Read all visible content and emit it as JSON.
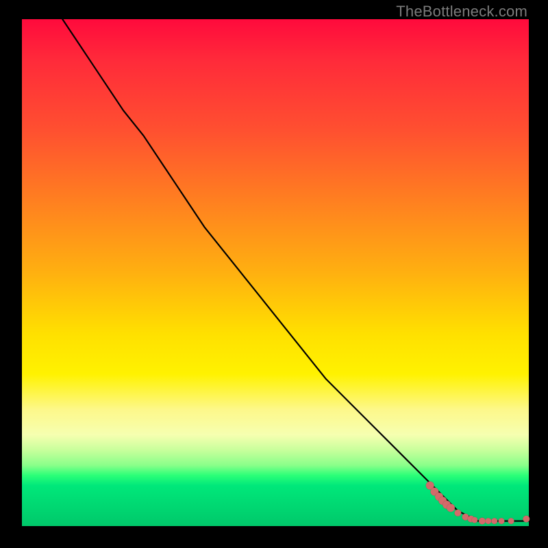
{
  "watermark": "TheBottleneck.com",
  "chart_data": {
    "type": "line",
    "title": "",
    "xlabel": "",
    "ylabel": "",
    "xlim": [
      0,
      100
    ],
    "ylim": [
      0,
      100
    ],
    "series": [
      {
        "name": "bottleneck-curve",
        "x": [
          8,
          12,
          16,
          20,
          24,
          28,
          32,
          36,
          40,
          44,
          48,
          52,
          56,
          60,
          64,
          68,
          72,
          76,
          80,
          82,
          84,
          86,
          88,
          90,
          92,
          94,
          96,
          98,
          100
        ],
        "y": [
          100,
          94,
          88,
          82,
          77,
          71,
          65,
          59,
          54,
          49,
          44,
          39,
          34,
          29,
          25,
          21,
          17,
          13,
          9,
          7,
          5,
          3,
          2,
          1,
          1,
          1,
          1,
          1,
          1
        ]
      }
    ],
    "points": {
      "name": "highlight-tail-points",
      "x": [
        80.5,
        81.4,
        82.3,
        83.0,
        83.8,
        84.6,
        86.0,
        87.5,
        88.6,
        89.3,
        90.8,
        92.0,
        93.2,
        94.6,
        96.5,
        99.5
      ],
      "y": [
        8.0,
        6.8,
        5.8,
        5.0,
        4.2,
        3.6,
        2.6,
        1.8,
        1.4,
        1.2,
        1.0,
        1.0,
        1.0,
        1.0,
        1.0,
        1.4
      ],
      "r": [
        6,
        6,
        6,
        6,
        6,
        6,
        5,
        5,
        5,
        4.5,
        5,
        4.5,
        4.5,
        4.5,
        4.5,
        5
      ]
    },
    "gradient_description": "vertical red-to-yellow-to-green heat background",
    "grid": false,
    "legend": false
  }
}
